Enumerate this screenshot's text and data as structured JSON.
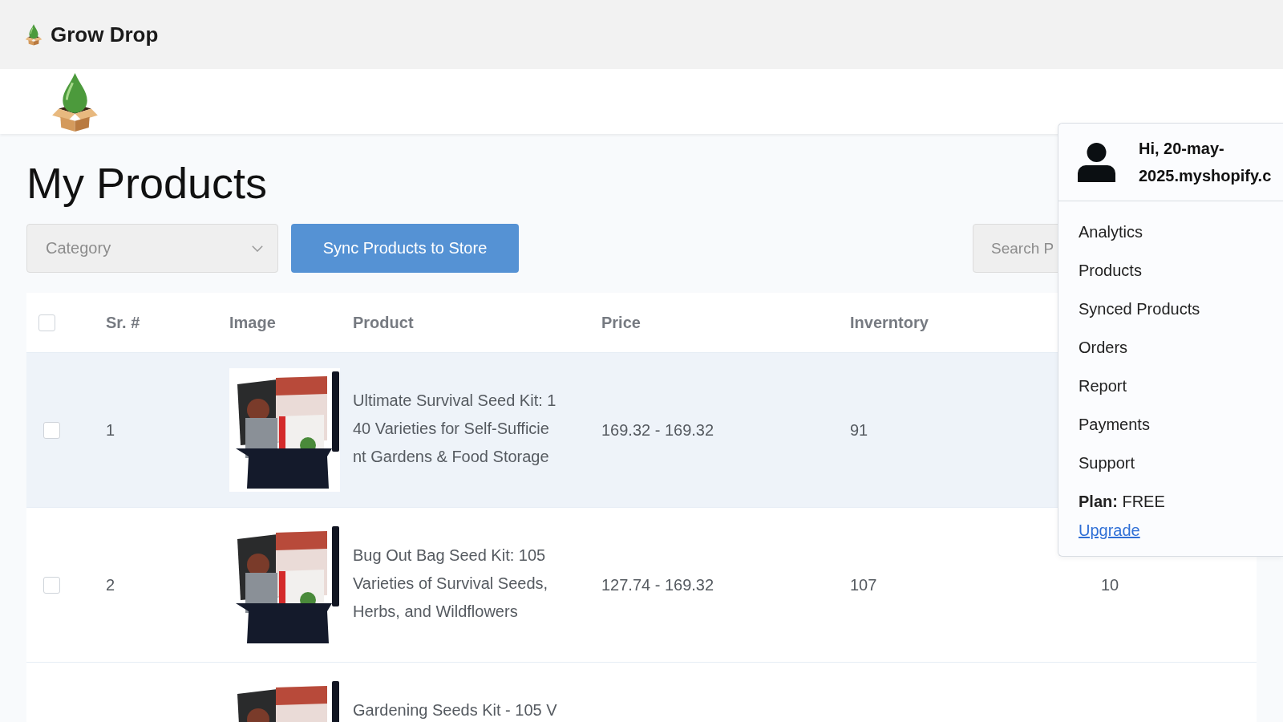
{
  "app_bar": {
    "brand": "Grow Drop"
  },
  "page": {
    "title": "My Products"
  },
  "toolbar": {
    "category_select": {
      "placeholder": "Category"
    },
    "sync_button": "Sync Products to Store",
    "search": {
      "placeholder": "Search P"
    }
  },
  "table": {
    "header_checkbox": {
      "checked": false
    },
    "columns": [
      "Sr. #",
      "Image",
      "Product",
      "Price",
      "Inverntory"
    ],
    "rows": [
      {
        "checked": false,
        "hovered": true,
        "sr_no": "1",
        "product": "Ultimate Survival Seed Kit: 140 Varieties for Self-Sufficient Gardens & Food Storage",
        "price": "169.32 - 169.32",
        "inventory": "91"
      },
      {
        "checked": false,
        "hovered": false,
        "sr_no": "2",
        "product": "Bug Out Bag Seed Kit: 105 Varieties of Survival Seeds, Herbs, and Wildflowers",
        "price": "127.74 - 169.32",
        "inventory": "107",
        "column_6": "10"
      },
      {
        "hovered": false,
        "product": "Gardening Seeds Kit - 105 V"
      }
    ]
  },
  "account_menu": {
    "greeting_lines": [
      "Hi, 20-may-",
      "2025.myshopify.c"
    ],
    "items": [
      "Analytics",
      "Products",
      "Synced Products",
      "Orders",
      "Report",
      "Payments",
      "Support"
    ],
    "plan": "**Plan:** FREE",
    "upgrade_link": "Upgrade"
  }
}
